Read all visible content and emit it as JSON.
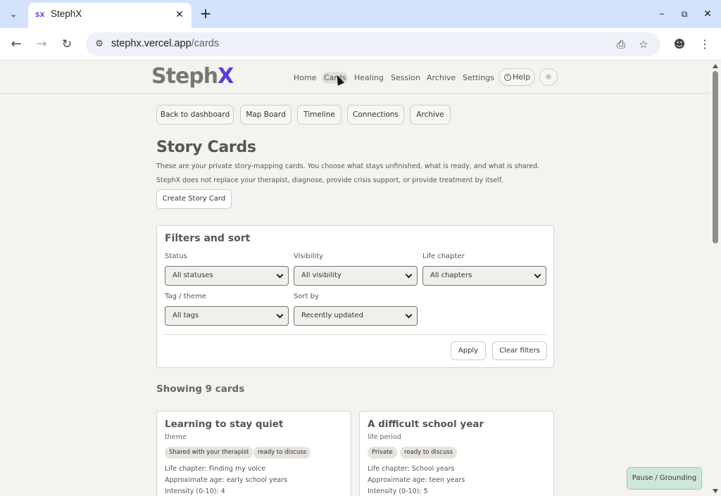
{
  "browser": {
    "tab_title": "StephX",
    "favicon_text": "SX",
    "url_host": "stephx.vercel.app",
    "url_path": "/cards"
  },
  "header": {
    "logo_main": "Steph",
    "logo_accent": "X",
    "nav": [
      "Home",
      "Cards",
      "Healing",
      "Session",
      "Archive",
      "Settings"
    ],
    "active_nav": "Cards",
    "help_label": "Help"
  },
  "subnav": [
    "Back to dashboard",
    "Map Board",
    "Timeline",
    "Connections",
    "Archive"
  ],
  "main": {
    "title": "Story Cards",
    "intro_1": "These are your private story-mapping cards. You choose what stays unfinished, what is ready, and what is shared.",
    "intro_2": "StephX does not replace your therapist, diagnose, provide crisis support, or provide treatment by itself.",
    "create_label": "Create Story Card"
  },
  "filters": {
    "title": "Filters and sort",
    "status": {
      "label": "Status",
      "value": "All statuses"
    },
    "visibility": {
      "label": "Visibility",
      "value": "All visibility"
    },
    "chapter": {
      "label": "Life chapter",
      "value": "All chapters"
    },
    "tag": {
      "label": "Tag / theme",
      "value": "All tags"
    },
    "sort": {
      "label": "Sort by",
      "value": "Recently updated"
    },
    "apply_label": "Apply",
    "clear_label": "Clear filters"
  },
  "showing": "Showing 9 cards",
  "cards": [
    {
      "title": "Learning to stay quiet",
      "type": "theme",
      "chips": [
        "Shared with your therapist",
        "ready to discuss"
      ],
      "chapter": "Life chapter: Finding my voice",
      "age": "Approximate age: early school years",
      "intensity": "Intensity (0-10): 4"
    },
    {
      "title": "A difficult school year",
      "type": "life period",
      "chips": [
        "Private",
        "ready to discuss"
      ],
      "chapter": "Life chapter: School years",
      "age": "Approximate age: teen years",
      "intensity": "Intensity (0-10): 5"
    }
  ],
  "pause_label": "Pause / Grounding"
}
